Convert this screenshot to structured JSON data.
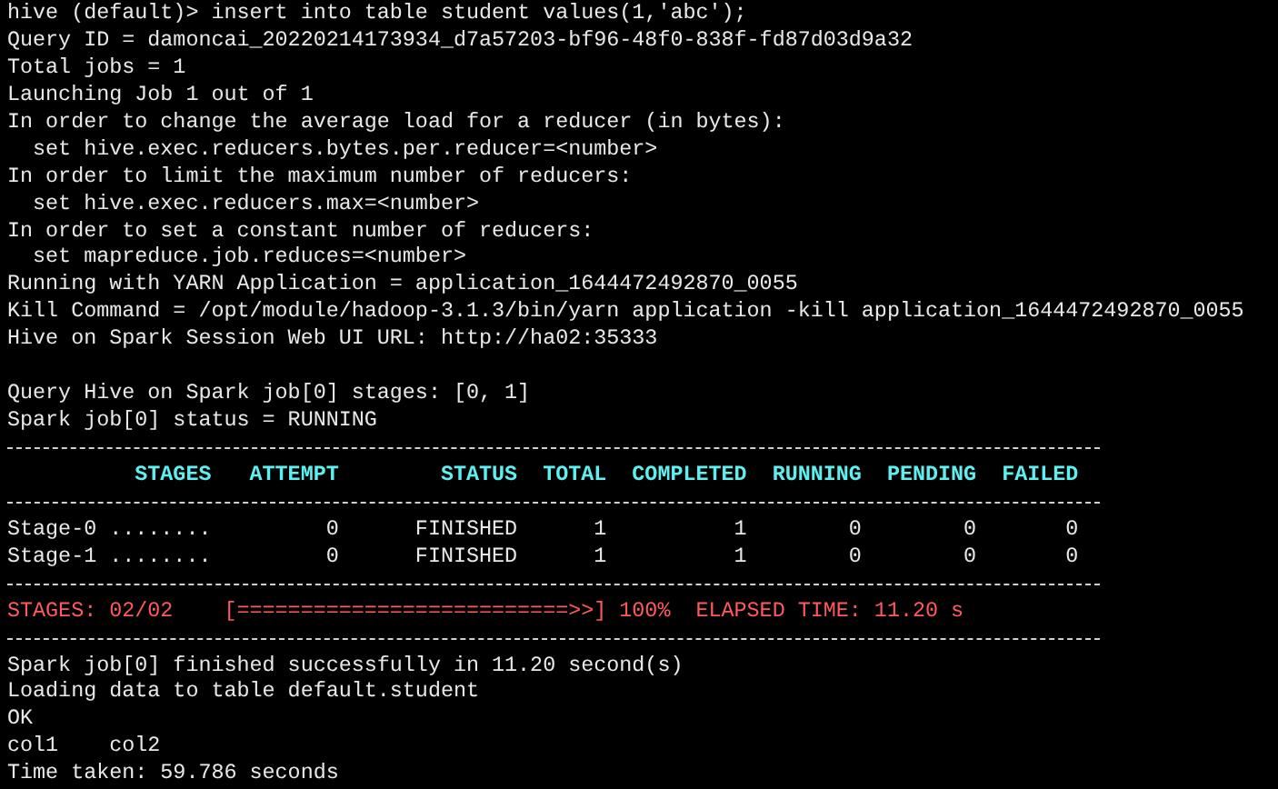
{
  "lines": [
    {
      "kind": "text",
      "text": "hive (default)> insert into table student values(1,'abc');"
    },
    {
      "kind": "text",
      "text": "Query ID = damoncai_20220214173934_d7a57203-bf96-48f0-838f-fd87d03d9a32"
    },
    {
      "kind": "text",
      "text": "Total jobs = 1"
    },
    {
      "kind": "text",
      "text": "Launching Job 1 out of 1"
    },
    {
      "kind": "text",
      "text": "In order to change the average load for a reducer (in bytes):"
    },
    {
      "kind": "text",
      "text": "  set hive.exec.reducers.bytes.per.reducer=<number>"
    },
    {
      "kind": "text",
      "text": "In order to limit the maximum number of reducers:"
    },
    {
      "kind": "text",
      "text": "  set hive.exec.reducers.max=<number>"
    },
    {
      "kind": "text",
      "text": "In order to set a constant number of reducers:"
    },
    {
      "kind": "text",
      "text": "  set mapreduce.job.reduces=<number>"
    },
    {
      "kind": "text",
      "text": "Running with YARN Application = application_1644472492870_0055"
    },
    {
      "kind": "text",
      "text": "Kill Command = /opt/module/hadoop-3.1.3/bin/yarn application -kill application_1644472492870_0055"
    },
    {
      "kind": "text",
      "text": "Hive on Spark Session Web UI URL: http://ha02:35333"
    },
    {
      "kind": "blank"
    },
    {
      "kind": "text",
      "text": "Query Hive on Spark job[0] stages: [0, 1]"
    },
    {
      "kind": "text",
      "text": "Spark job[0] status = RUNNING"
    },
    {
      "kind": "rule"
    },
    {
      "kind": "header",
      "text": "          STAGES   ATTEMPT        STATUS  TOTAL  COMPLETED  RUNNING  PENDING  FAILED"
    },
    {
      "kind": "rule"
    },
    {
      "kind": "row",
      "text": "Stage-0 ........         0      FINISHED      1          1        0        0       0"
    },
    {
      "kind": "row",
      "text": "Stage-1 ........         0      FINISHED      1          1        0        0       0"
    },
    {
      "kind": "rule"
    },
    {
      "kind": "progress",
      "text": "STAGES: 02/02    [==========================>>] 100%  ELAPSED TIME: 11.20 s"
    },
    {
      "kind": "rule"
    },
    {
      "kind": "text",
      "text": "Spark job[0] finished successfully in 11.20 second(s)"
    },
    {
      "kind": "text",
      "text": "Loading data to table default.student"
    },
    {
      "kind": "text",
      "text": "OK"
    },
    {
      "kind": "text",
      "text": "col1    col2"
    },
    {
      "kind": "text",
      "text": "Time taken: 59.786 seconds"
    }
  ]
}
